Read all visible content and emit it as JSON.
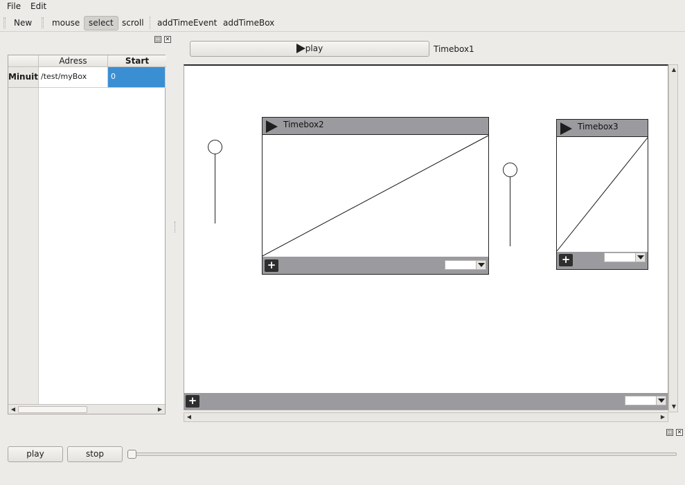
{
  "menubar": {
    "file": "File",
    "edit": "Edit"
  },
  "toolbar": {
    "new": "New",
    "mouse": "mouse",
    "select": "select",
    "scroll": "scroll",
    "add_time_event": "addTimeEvent",
    "add_time_box": "addTimeBox",
    "active_tool": "select"
  },
  "table": {
    "headers": [
      "",
      "Adress",
      "Start"
    ],
    "rows": [
      {
        "device": "Minuit",
        "address": "/test/myBox",
        "start": "0"
      }
    ]
  },
  "main": {
    "play_label": "play",
    "timebox_name": "Timebox1"
  },
  "timeboxes": [
    {
      "name": "Timebox2"
    },
    {
      "name": "Timebox3"
    }
  ],
  "bottom": {
    "play_label": "play",
    "stop_label": "stop",
    "slider_value": 0
  },
  "colors": {
    "selection": "#3a8fd3",
    "timebox_bar": "#9b9a9e",
    "background": "#edebe8"
  }
}
